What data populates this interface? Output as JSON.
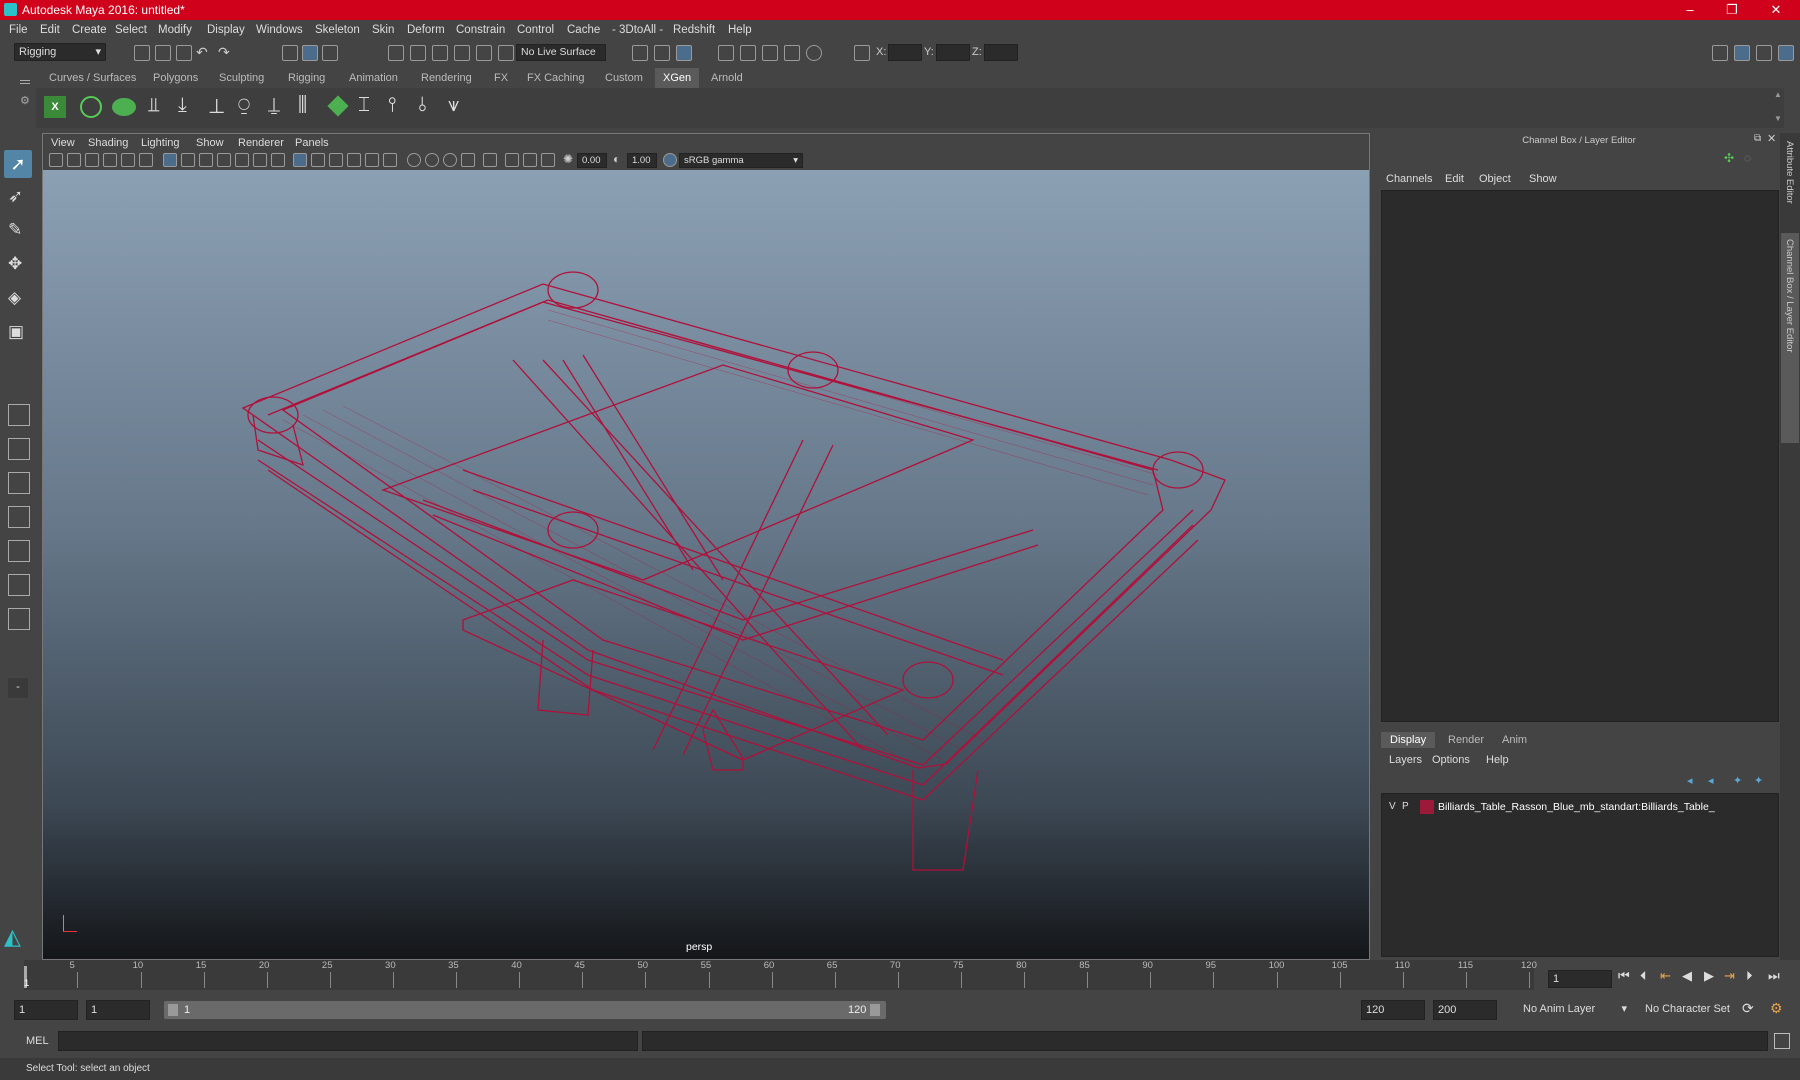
{
  "window": {
    "title": "Autodesk Maya 2016: untitled*",
    "min": "–",
    "max": "❐",
    "close": "✕"
  },
  "menu": [
    "File",
    "Edit",
    "Create",
    "Select",
    "Modify",
    "Display",
    "Windows",
    "Skeleton",
    "Skin",
    "Deform",
    "Constrain",
    "Control",
    "Cache",
    "- 3DtoAll -",
    "Redshift",
    "Help"
  ],
  "toolbar": {
    "mode": "Rigging",
    "live_surface": "No Live Surface",
    "x_label": "X:",
    "y_label": "Y:",
    "z_label": "Z:"
  },
  "shelf_tabs": [
    "Curves / Surfaces",
    "Polygons",
    "Sculpting",
    "Rigging",
    "Animation",
    "Rendering",
    "FX",
    "FX Caching",
    "Custom",
    "XGen",
    "Arnold"
  ],
  "shelf_active": "XGen",
  "viewport": {
    "menu": [
      "View",
      "Shading",
      "Lighting",
      "Show",
      "Renderer",
      "Panels"
    ],
    "exposure": "0.00",
    "gamma": "1.00",
    "color_space": "sRGB gamma",
    "camera_label": "persp"
  },
  "channel_box": {
    "title": "Channel Box / Layer Editor",
    "menu": [
      "Channels",
      "Edit",
      "Object",
      "Show"
    ]
  },
  "layer_editor": {
    "tabs": [
      "Display",
      "Render",
      "Anim"
    ],
    "active_tab": "Display",
    "menu": [
      "Layers",
      "Options",
      "Help"
    ],
    "layers": [
      {
        "v": "V",
        "p": "P",
        "name": "Billiards_Table_Rasson_Blue_mb_standart:Billiards_Table_",
        "color": "#9b1a3a"
      }
    ]
  },
  "side_tabs": {
    "attribute_editor": "Attribute Editor",
    "channel_box": "Channel Box / Layer Editor"
  },
  "timeline": {
    "ticks": [
      "5",
      "10",
      "15",
      "20",
      "25",
      "30",
      "35",
      "40",
      "45",
      "50",
      "55",
      "60",
      "65",
      "70",
      "75",
      "80",
      "85",
      "90",
      "95",
      "100",
      "105",
      "110",
      "115",
      "120"
    ],
    "start_marker": "1",
    "current_frame": "1"
  },
  "range": {
    "start": "1",
    "playback_start": "1",
    "slider_start": "1",
    "slider_end": "120",
    "playback_end": "120",
    "end": "200",
    "anim_layer": "No Anim Layer",
    "character_set": "No Character Set"
  },
  "command": {
    "lang": "MEL"
  },
  "status": {
    "help": "Select Tool: select an object"
  },
  "colors": {
    "title_bar": "#d0021b",
    "wireframe": "#b0103a",
    "accent": "#4aa3df"
  }
}
